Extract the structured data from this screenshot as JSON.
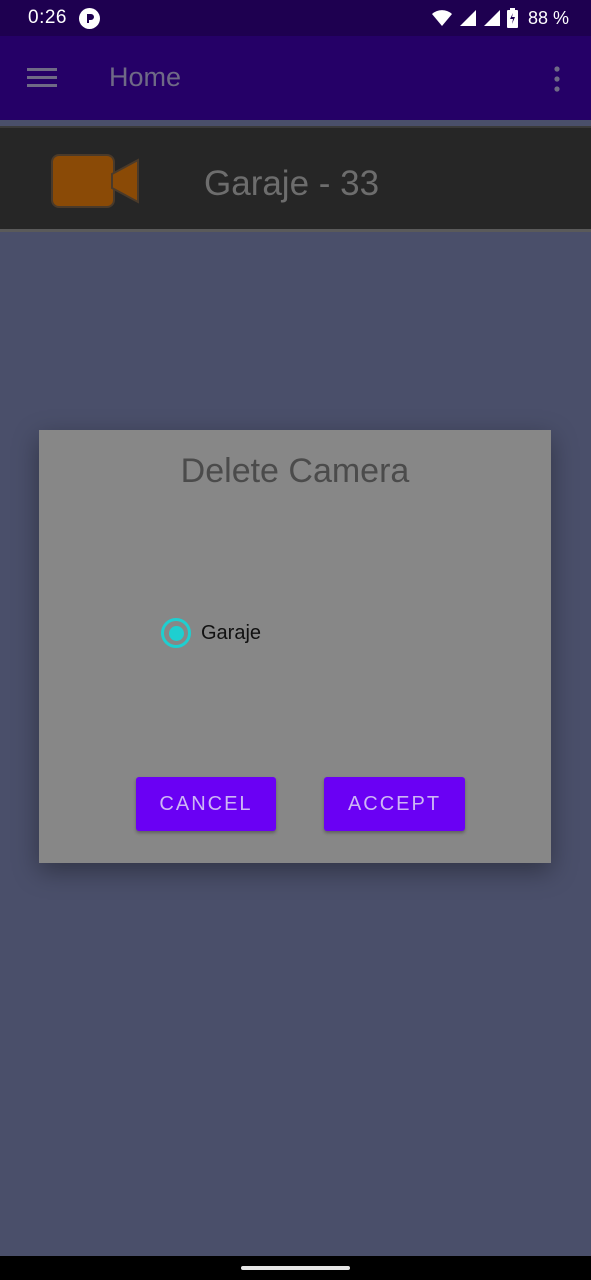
{
  "status_bar": {
    "time": "0:26",
    "battery": "88 %",
    "icons": [
      "app-notification-icon",
      "wifi-icon",
      "signal-icon",
      "signal-icon",
      "battery-icon"
    ]
  },
  "app_bar": {
    "title": "Home",
    "menu_icon": "menu-icon",
    "overflow_icon": "more-vert-icon",
    "background": "#250067"
  },
  "camera_list": {
    "items": [
      {
        "label": "Garaje - 33",
        "icon": "video-camera-icon",
        "icon_color": "#8a4a06"
      }
    ]
  },
  "dialog": {
    "title": "Delete Camera",
    "options": [
      {
        "label": "Garaje",
        "selected": true
      }
    ],
    "cancel_label": "CANCEL",
    "accept_label": "ACCEPT",
    "accent_color": "#1ecfd0",
    "button_color": "#6a00f4"
  }
}
